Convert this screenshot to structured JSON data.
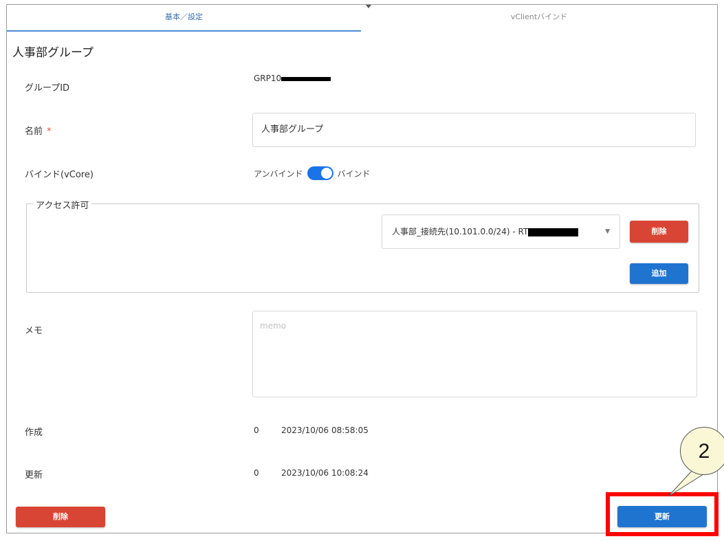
{
  "tabs": [
    {
      "label": "基本／設定",
      "active": true
    },
    {
      "label": "vClientバインド",
      "active": false
    }
  ],
  "page_title": "人事部グループ",
  "fields": {
    "group_id": {
      "label": "グループID",
      "value": "GRP10"
    },
    "name": {
      "label": "名前",
      "required_mark": "*",
      "value": "人事部グループ"
    },
    "bind": {
      "label": "バインド(vCore)",
      "off_label": "アンバインド",
      "on_label": "バインド",
      "state": "on"
    },
    "access": {
      "legend": "アクセス許可",
      "selected": "人事部_接続先(10.101.0.0/24) - RT",
      "delete_label": "削除",
      "add_label": "追加"
    },
    "memo": {
      "label": "メモ",
      "placeholder": "memo"
    },
    "created": {
      "label": "作成",
      "user": "0",
      "timestamp": "2023/10/06 08:58:05"
    },
    "updated": {
      "label": "更新",
      "user": "0",
      "timestamp": "2023/10/06 10:08:24"
    }
  },
  "footer": {
    "delete_label": "削除",
    "update_label": "更新"
  },
  "annotation": {
    "step_number": "2",
    "color": "#ff0000"
  },
  "colors": {
    "primary": "#1f74d0",
    "danger": "#d94534",
    "toggle_on": "#1a73e8"
  }
}
